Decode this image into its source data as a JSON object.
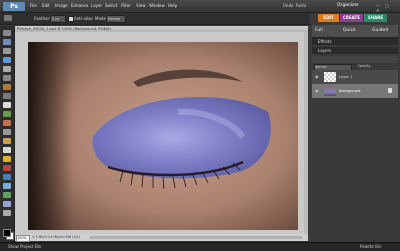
{
  "app": {
    "logo": "Ps"
  },
  "menu": [
    "File",
    "Edit",
    "Image",
    "Enhance",
    "Layer",
    "Select",
    "Filter",
    "View",
    "Window",
    "Help"
  ],
  "top_right": {
    "undo": "Undo",
    "redo": "Redo",
    "organizer": "Organizer"
  },
  "options": {
    "feather_label": "Feather:",
    "feather_value": "0 px",
    "antialias_label": "Anti-alias",
    "mode_label": "Mode:",
    "mode_value": "Normal"
  },
  "mode_tabs": {
    "edit": "EDIT",
    "create": "CREATE",
    "share": "SHARE"
  },
  "sub_tabs": {
    "full": "Full",
    "quick": "Quick",
    "guided": "Guided"
  },
  "panels": {
    "effects": "Effects",
    "layers": "Layers",
    "blend_mode": "Normal",
    "opacity_label": "Opacity:"
  },
  "layers": [
    {
      "name": "Layer 1"
    },
    {
      "name": "Background"
    }
  ],
  "document": {
    "title": "Pinkeye_0005A_1.psd @ 100% (Background, RGB/8)",
    "zoom": "100%",
    "info": "1.7 Mb/3.14 Mb/cm Mb (1/1)"
  },
  "status": {
    "project_bin": "Show Project Bin",
    "palette_bin": "Palette Bin"
  },
  "colors": {
    "edit_tab": "#e07a1d",
    "create_tab": "#8a3e92",
    "share_tab": "#2c8a6a",
    "eyeshadow": "#7f80c8",
    "skin": "#b08a78"
  }
}
